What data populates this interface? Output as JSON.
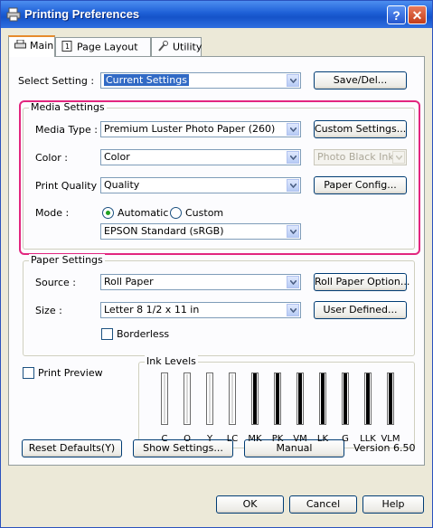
{
  "window": {
    "title": "Printing Preferences",
    "help_btn": "?",
    "close_btn": "✕"
  },
  "tabs": [
    {
      "label": "Main"
    },
    {
      "label": "Page Layout"
    },
    {
      "label": "Utility"
    }
  ],
  "select_setting": {
    "label": "Select Setting :",
    "value": "Current Settings",
    "button": "Save/Del..."
  },
  "media": {
    "title": "Media Settings",
    "media_type": {
      "label": "Media Type :",
      "value": "Premium Luster Photo Paper (260)",
      "button": "Custom Settings..."
    },
    "color": {
      "label": "Color :",
      "value": "Color",
      "ink": "Photo Black Ink"
    },
    "print_quality": {
      "label": "Print Quality :",
      "value": "Quality",
      "button": "Paper Config..."
    },
    "mode": {
      "label": "Mode :",
      "automatic": "Automatic",
      "custom": "Custom",
      "selected": "Automatic",
      "value": "EPSON Standard (sRGB)"
    }
  },
  "paper": {
    "title": "Paper Settings",
    "source": {
      "label": "Source :",
      "value": "Roll Paper",
      "button": "Roll Paper Option..."
    },
    "size": {
      "label": "Size :",
      "value": "Letter 8 1/2 x 11 in",
      "button": "User Defined..."
    },
    "borderless": "Borderless"
  },
  "print_preview": "Print Preview",
  "ink_levels": {
    "title": "Ink Levels",
    "inks": [
      {
        "label": "C",
        "level": 0
      },
      {
        "label": "O",
        "level": 0
      },
      {
        "label": "Y",
        "level": 0
      },
      {
        "label": "LC",
        "level": 0
      },
      {
        "label": "MK",
        "level": 1
      },
      {
        "label": "PK",
        "level": 1
      },
      {
        "label": "VM",
        "level": 1
      },
      {
        "label": "LK",
        "level": 1
      },
      {
        "label": "G",
        "level": 1
      },
      {
        "label": "LLK",
        "level": 1
      },
      {
        "label": "VLM",
        "level": 1
      }
    ]
  },
  "footer": {
    "reset": "Reset Defaults(Y)",
    "show": "Show Settings...",
    "manual": "Manual",
    "version": "Version 6.50"
  },
  "dialog": {
    "ok": "OK",
    "cancel": "Cancel",
    "help": "Help"
  },
  "colors": {
    "highlight": "#e2267f",
    "titlebar": "#1d5fd6"
  }
}
